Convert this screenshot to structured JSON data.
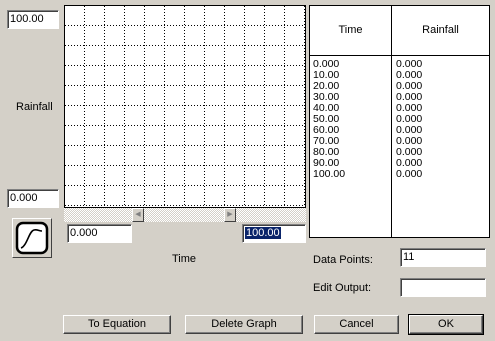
{
  "graph": {
    "y_max": "100.00",
    "y_min": "0.000",
    "y_axis_label": "Rainfall",
    "x_min": "0.000",
    "x_max": "100.00",
    "x_axis_label": "Time"
  },
  "table": {
    "headers": [
      "Time",
      "Rainfall"
    ],
    "rows": [
      [
        "0.000",
        "0.000"
      ],
      [
        "10.00",
        "0.000"
      ],
      [
        "20.00",
        "0.000"
      ],
      [
        "30.00",
        "0.000"
      ],
      [
        "40.00",
        "0.000"
      ],
      [
        "50.00",
        "0.000"
      ],
      [
        "60.00",
        "0.000"
      ],
      [
        "70.00",
        "0.000"
      ],
      [
        "80.00",
        "0.000"
      ],
      [
        "90.00",
        "0.000"
      ],
      [
        "100.00",
        "0.000"
      ]
    ]
  },
  "fields": {
    "data_points_label": "Data Points:",
    "data_points_value": "11",
    "edit_output_label": "Edit Output:",
    "edit_output_value": ""
  },
  "buttons": {
    "to_equation": "To Equation",
    "delete_graph": "Delete Graph",
    "cancel": "Cancel",
    "ok": "OK"
  },
  "icons": {
    "curve_button": "curve-shape-icon",
    "scroll_left": "arrow-left-icon",
    "scroll_right": "arrow-right-icon"
  }
}
